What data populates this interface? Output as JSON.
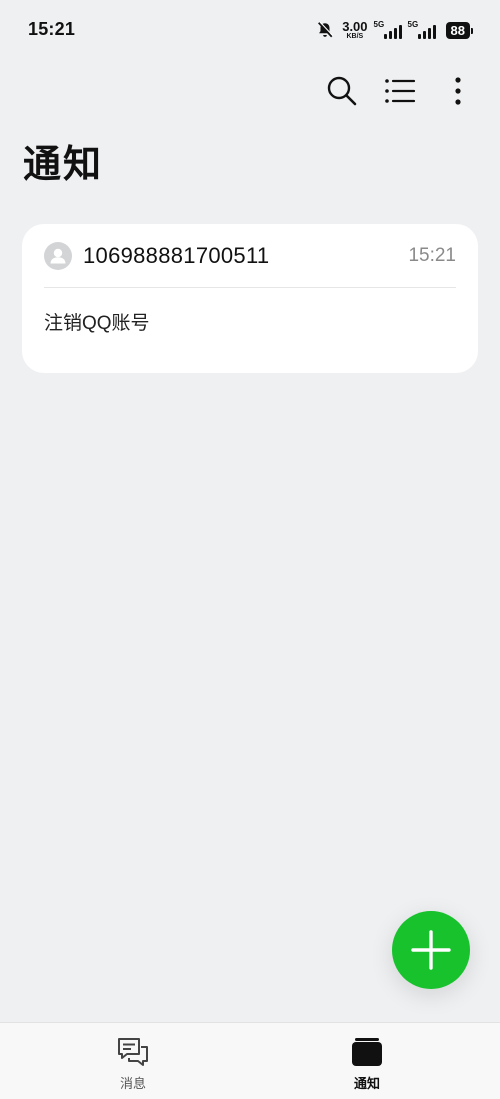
{
  "status_bar": {
    "time": "15:21",
    "net_speed": "3.00",
    "net_speed_unit": "KB/S",
    "sim1_tag": "5G",
    "sim2_tag": "5G",
    "battery": "88",
    "icons": [
      "mute-icon",
      "signal-icon",
      "battery-icon"
    ]
  },
  "toolbar": {
    "icons": [
      "search-icon",
      "list-icon",
      "more-icon"
    ]
  },
  "page": {
    "title": "通知"
  },
  "notifications": [
    {
      "sender": "106988881700511",
      "time": "15:21",
      "body": "注销QQ账号"
    }
  ],
  "fab": {
    "icon": "plus-icon"
  },
  "bottom_nav": {
    "items": [
      {
        "label": "消息",
        "icon": "chat-icon",
        "active": false
      },
      {
        "label": "通知",
        "icon": "notification-folder-icon",
        "active": true
      }
    ]
  },
  "colors": {
    "accent": "#17c22c",
    "background": "#eff0f2",
    "card": "#ffffff"
  }
}
